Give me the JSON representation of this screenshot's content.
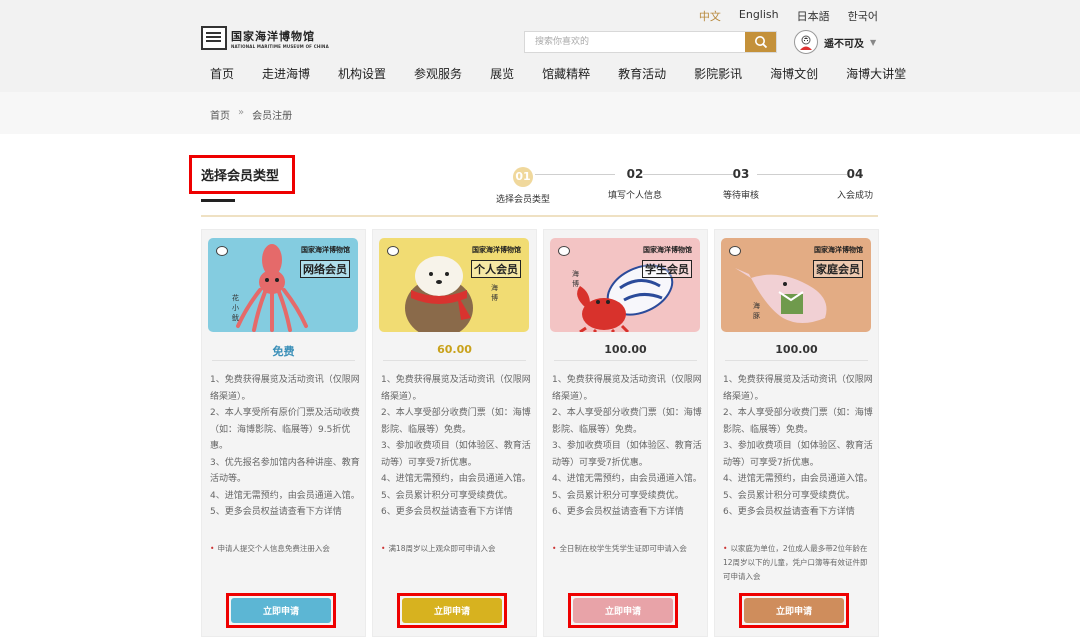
{
  "header": {
    "languages": [
      "中文",
      "English",
      "日本語",
      "한국어"
    ],
    "active_language": "中文",
    "logo": {
      "cn": "国家海洋博物馆",
      "en": "NATIONAL MARITIME MUSEUM OF CHINA"
    },
    "search": {
      "placeholder": "搜索你喜欢的",
      "icon": "search-icon"
    },
    "user": {
      "name": "遥不可及",
      "icon": "avatar-icon"
    },
    "nav": [
      "首页",
      "走进海博",
      "机构设置",
      "参观服务",
      "展览",
      "馆藏精粹",
      "教育活动",
      "影院影讯",
      "海博文创",
      "海博大讲堂"
    ]
  },
  "breadcrumb": {
    "home": "首页",
    "separator": "»",
    "current": "会员注册"
  },
  "page": {
    "title": "选择会员类型"
  },
  "steps": [
    {
      "num": "01",
      "label": "选择会员类型"
    },
    {
      "num": "02",
      "label": "填写个人信息"
    },
    {
      "num": "03",
      "label": "等待审核"
    },
    {
      "num": "04",
      "label": "入会成功"
    }
  ],
  "cards": [
    {
      "museum": "国家海洋博物馆",
      "kind": "网络会员",
      "price": "免费",
      "bg": "#84cce0",
      "price_color": "#3a8fb8",
      "button_color": "#5cb6d4",
      "benefits": [
        "1、免费获得展览及活动资讯（仅限网络渠道）。",
        "2、本人享受所有原价门票及活动收费（如：海博影院、临展等）9.5折优惠。",
        "3、优先报名参加馆内各种讲座、教育活动等。",
        "4、进馆无需预约，由会员通道入馆。",
        "5、更多会员权益请查看下方详情"
      ],
      "note": "申请人提交个人信息免费注册入会",
      "button": "立即申请",
      "mascot": "squid"
    },
    {
      "museum": "国家海洋博物馆",
      "kind": "个人会员",
      "price": "60.00",
      "bg": "#f1dc73",
      "price_color": "#c9a21c",
      "button_color": "#d7b21f",
      "benefits": [
        "1、免费获得展览及活动资讯（仅限网络渠道）。",
        "2、本人享受部分收费门票（如：海博影院、临展等）免费。",
        "3、参加收费项目（如体验区、教育活动等）可享受7折优惠。",
        "4、进馆无需预约，由会员通道入馆。",
        "5、会员累计积分可享受续费优。",
        "6、更多会员权益请查看下方详情"
      ],
      "note": "满18周岁以上观众即可申请入会",
      "button": "立即申请",
      "mascot": "seal"
    },
    {
      "museum": "国家海洋博物馆",
      "kind": "学生会员",
      "price": "100.00",
      "bg": "#f3c4c4",
      "price_color": "#333333",
      "button_color": "#e8a3a8",
      "benefits": [
        "1、免费获得展览及活动资讯（仅限网络渠道）。",
        "2、本人享受部分收费门票（如：海博影院、临展等）免费。",
        "3、参加收费项目（如体验区、教育活动等）可享受7折优惠。",
        "4、进馆无需预约，由会员通道入馆。",
        "5、会员累计积分可享受续费优。",
        "6、更多会员权益请查看下方详情"
      ],
      "note": "全日制在校学生凭学生证即可申请入会",
      "button": "立即申请",
      "mascot": "crab"
    },
    {
      "museum": "国家海洋博物馆",
      "kind": "家庭会员",
      "price": "100.00",
      "bg": "#e3ac84",
      "price_color": "#333333",
      "button_color": "#cf8d5c",
      "benefits": [
        "1、免费获得展览及活动资讯（仅限网络渠道）。",
        "2、本人享受部分收费门票（如：海博影院、临展等）免费。",
        "3、参加收费项目（如体验区、教育活动等）可享受7折优惠。",
        "4、进馆无需预约，由会员通道入馆。",
        "5、会员累计积分可享受续费优。",
        "6、更多会员权益请查看下方详情"
      ],
      "note": "以家庭为单位，2位成人最多带2位年龄在12周岁以下的儿童，凭户口簿等有效证件即可申请入会",
      "button": "立即申请",
      "mascot": "dolphin"
    }
  ]
}
